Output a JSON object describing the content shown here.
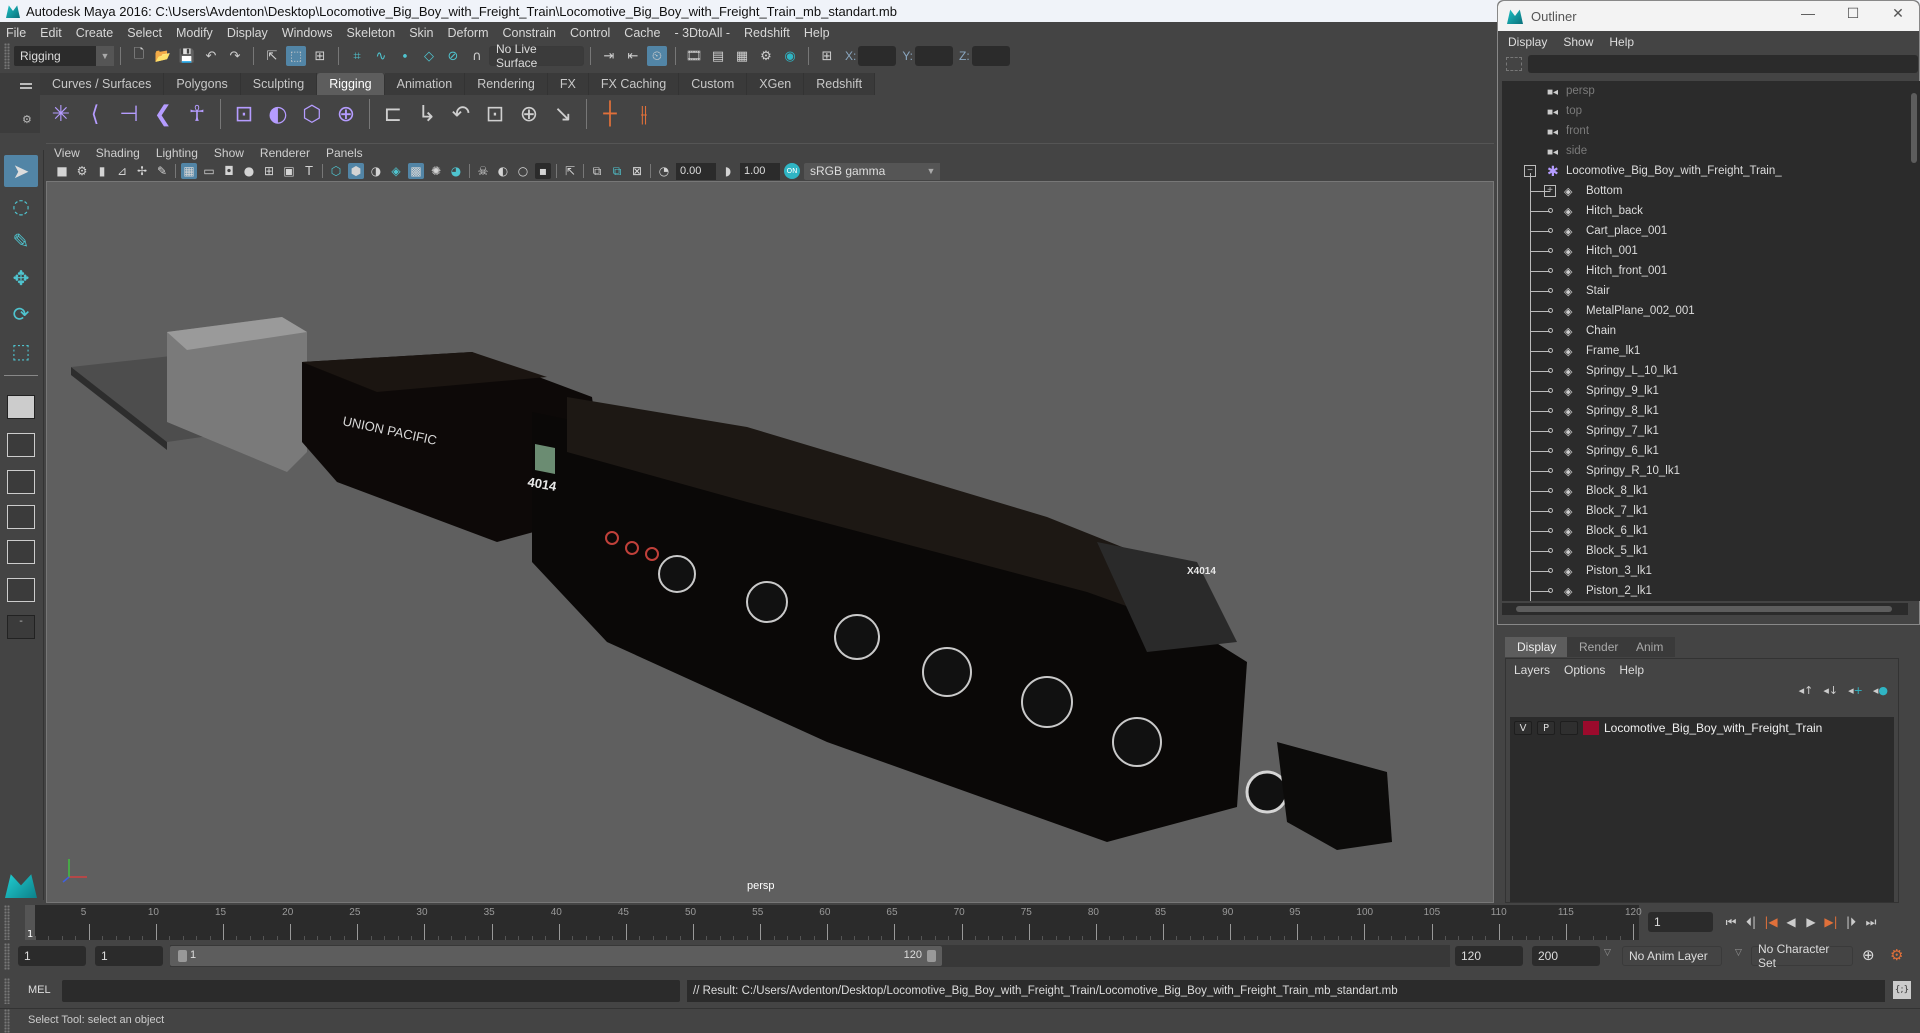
{
  "window": {
    "title": "Autodesk Maya 2016: C:\\Users\\Avdenton\\Desktop\\Locomotive_Big_Boy_with_Freight_Train\\Locomotive_Big_Boy_with_Freight_Train_mb_standart.mb"
  },
  "menubar": [
    "File",
    "Edit",
    "Create",
    "Select",
    "Modify",
    "Display",
    "Windows",
    "Skeleton",
    "Skin",
    "Deform",
    "Constrain",
    "Control",
    "Cache",
    "- 3DtoAll -",
    "Redshift",
    "Help"
  ],
  "statusline": {
    "menuset": "Rigging",
    "live_surface": "No Live Surface",
    "x_label": "X:",
    "y_label": "Y:",
    "z_label": "Z:",
    "x_value": "",
    "y_value": "",
    "z_value": ""
  },
  "shelf": {
    "tabs": [
      "Curves / Surfaces",
      "Polygons",
      "Sculpting",
      "Rigging",
      "Animation",
      "Rendering",
      "FX",
      "FX Caching",
      "Custom",
      "XGen",
      "Redshift"
    ],
    "active_tab": "Rigging",
    "icons": [
      "joint-tool-icon",
      "ik-handle-icon",
      "ik-spline-icon",
      "ik-spring-icon",
      "humanik-icon",
      "paint-weights-icon",
      "smooth-bind-icon",
      "lattice-icon",
      "cluster-icon",
      "parent-constraint-icon",
      "point-constraint-icon",
      "orient-constraint-icon",
      "scale-constraint-icon",
      "aim-constraint-icon",
      "pole-vector-icon",
      "add-influence-icon",
      "constraint-link-icon"
    ]
  },
  "viewport": {
    "menu": [
      "View",
      "Shading",
      "Lighting",
      "Show",
      "Renderer",
      "Panels"
    ],
    "exposure": "0.00",
    "gamma": "1.00",
    "color_space": "sRGB gamma",
    "camera_label": "persp",
    "model_texts": {
      "tender_lettering": "UNION PACIFIC",
      "cab_number": "4014",
      "smokebox_number": "X4014"
    }
  },
  "outliner": {
    "title": "Outliner",
    "menu": [
      "Display",
      "Show",
      "Help"
    ],
    "search_value": "",
    "cameras": [
      "persp",
      "top",
      "front",
      "side"
    ],
    "root": "Locomotive_Big_Boy_with_Freight_Train_",
    "children": [
      "Bottom",
      "Hitch_back",
      "Cart_place_001",
      "Hitch_001",
      "Hitch_front_001",
      "Stair",
      "MetalPlane_002_001",
      "Chain",
      "Frame_lk1",
      "Springy_L_10_lk1",
      "Springy_9_lk1",
      "Springy_8_lk1",
      "Springy_7_lk1",
      "Springy_6_lk1",
      "Springy_R_10_lk1",
      "Block_8_lk1",
      "Block_7_lk1",
      "Block_6_lk1",
      "Block_5_lk1",
      "Piston_3_lk1",
      "Piston_2_lk1"
    ]
  },
  "layer_editor": {
    "tabs": [
      "Display",
      "Render",
      "Anim"
    ],
    "active_tab": "Display",
    "menu": [
      "Layers",
      "Options",
      "Help"
    ],
    "layers": [
      {
        "visible": "V",
        "playback": "P",
        "name": "Locomotive_Big_Boy_with_Freight_Train",
        "color": "#9b0a2c"
      }
    ]
  },
  "timeline": {
    "ticks": [
      5,
      10,
      15,
      20,
      25,
      30,
      35,
      40,
      45,
      50,
      55,
      60,
      65,
      70,
      75,
      80,
      85,
      90,
      95,
      100,
      105,
      110,
      115,
      120
    ],
    "start": 1,
    "end": 120,
    "current_frame_label": "1",
    "current_frame": "1"
  },
  "range": {
    "start": "1",
    "playback_start": "1",
    "range_start_label": "1",
    "range_end_label": "120",
    "playback_end": "120",
    "end": "200",
    "anim_layer": "No Anim Layer",
    "character_set": "No Character Set"
  },
  "command": {
    "language": "MEL",
    "input_value": "",
    "result": "// Result: C:/Users/Avdenton/Desktop/Locomotive_Big_Boy_with_Freight_Train/Locomotive_Big_Boy_with_Freight_Train_mb_standart.mb"
  },
  "helpline": "Select Tool: select an object",
  "colors": {
    "accent": "#5285a6",
    "maya_teal": "#1fc7c9",
    "key_orange": "#e0703a",
    "layer_color": "#9b0a2c"
  }
}
